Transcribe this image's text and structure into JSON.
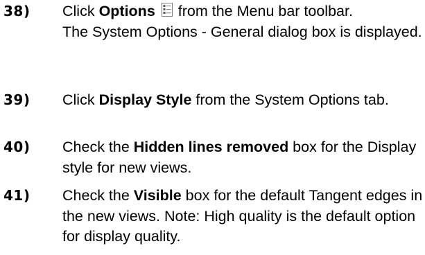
{
  "steps": [
    {
      "number": "38)",
      "line1": {
        "pre": "Click ",
        "bold": "Options",
        "post": "from the Menu bar toolbar."
      },
      "rest": "The System Options - General dialog box is displayed.",
      "icon": "options-icon"
    },
    {
      "number": "39)",
      "pre": "Click ",
      "bold": "Display Style",
      "post": " from the System Options tab."
    },
    {
      "number": "40)",
      "pre": "Check the ",
      "bold": "Hidden lines removed",
      "post": " box for the Display style for new views."
    },
    {
      "number": "41)",
      "pre": "Check the ",
      "bold": "Visible",
      "post": " box for the default Tangent edges in the new views.  Note: High quality is the default option for display quality."
    }
  ]
}
